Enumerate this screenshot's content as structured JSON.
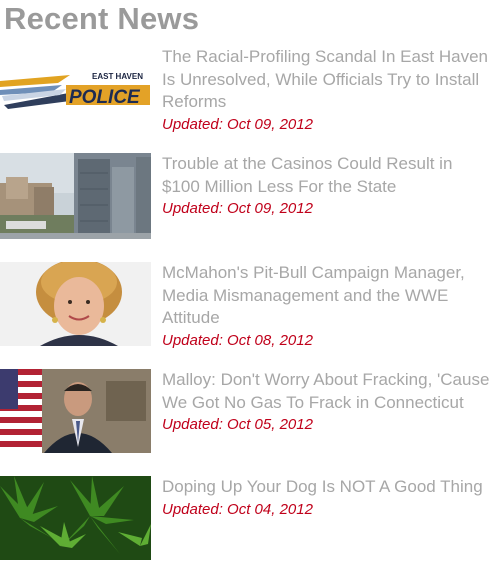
{
  "widget": {
    "title": "Recent News"
  },
  "articles": [
    {
      "headline": "The Racial-Profiling Scandal In East Haven Is Unresolved, While Officials Try to Install Reforms",
      "date": "Updated: Oct 09, 2012",
      "thumb": {
        "icon": "east-haven-police-logo",
        "logo_top": "EAST HAVEN",
        "logo_bottom": "POLICE"
      }
    },
    {
      "headline": "Trouble at the Casinos Could Result in $100 Million Less For the State",
      "date": "Updated: Oct 09, 2012",
      "thumb": {
        "icon": "casino-buildings-photo"
      }
    },
    {
      "headline": "McMahon's Pit-Bull Campaign Manager, Media Mismanagement and the WWE Attitude",
      "date": "Updated: Oct 08, 2012",
      "thumb": {
        "icon": "woman-portrait-photo"
      }
    },
    {
      "headline": "Malloy: Don't Worry About Fracking, 'Cause We Got No Gas To Frack in Connecticut",
      "date": "Updated: Oct 05, 2012",
      "thumb": {
        "icon": "man-with-flag-photo"
      }
    },
    {
      "headline": "Doping Up Your Dog Is NOT A Good Thing",
      "date": "Updated: Oct 04, 2012",
      "thumb": {
        "icon": "cannabis-leaves-photo"
      }
    }
  ],
  "colors": {
    "title": "#9a9a9a",
    "headline": "#a7a7a7",
    "date": "#c0001a"
  }
}
